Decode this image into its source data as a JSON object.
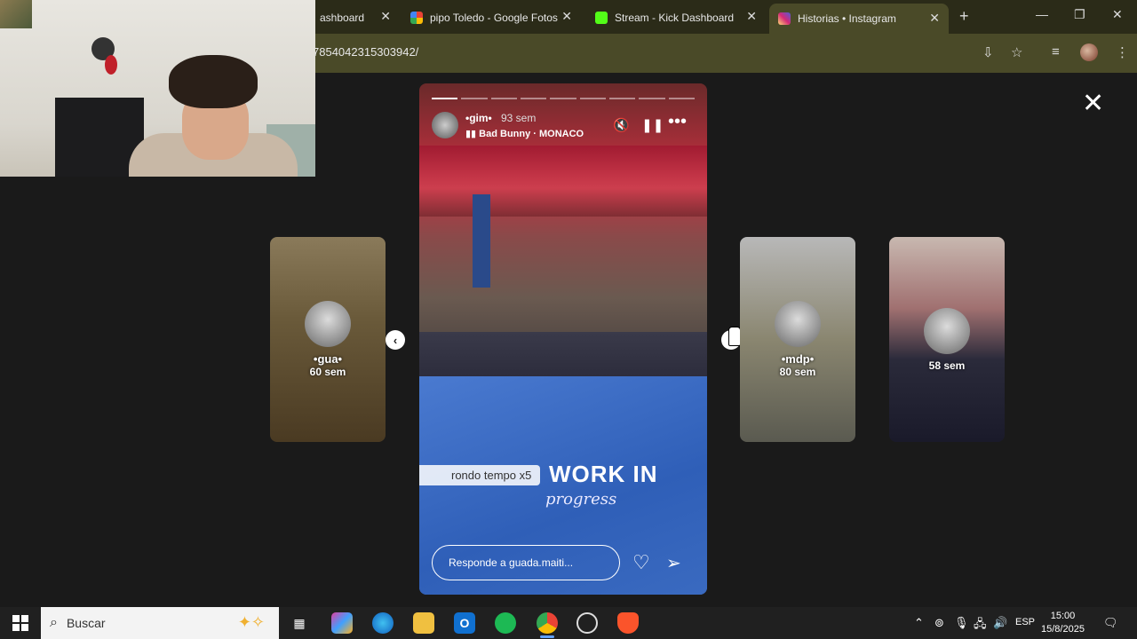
{
  "browser": {
    "tabs": [
      {
        "label": "ashboard",
        "favicon_color": "#2b2b18"
      },
      {
        "label": "pipo Toledo - Google Fotos",
        "favicon_color": "#ea4335"
      },
      {
        "label": "Stream - Kick Dashboard",
        "favicon_color": "#53fc18"
      },
      {
        "label": "Historias • Instagram",
        "favicon_color": "#d62976"
      }
    ],
    "tab_close": "✕",
    "new_tab": "+",
    "url": "7854042315303942/",
    "window_controls": {
      "minimize": "—",
      "restore": "❐",
      "close": "✕"
    }
  },
  "story_viewer": {
    "close": "✕",
    "prev_arrow": "‹",
    "next_arrow": "›",
    "side_stories": [
      {
        "user": "•gua•",
        "time": "60 sem"
      },
      {
        "user": "•mdp•",
        "time": "80 sem"
      },
      {
        "user": "",
        "time": "58 sem"
      }
    ],
    "main": {
      "user": "•gim•",
      "time": "93 sem",
      "music": "Bad Bunny · MONACO",
      "sticker_text": "rondo tempo x5",
      "overlay_title": "WORK IN",
      "overlay_sub": "progress",
      "reply_placeholder": "Responde a guada.maiti...",
      "progress_segments": 9,
      "progress_done": 1
    }
  },
  "taskbar": {
    "search_placeholder": "Buscar",
    "language": "ESP",
    "time": "15:00",
    "date": "15/8/2025"
  }
}
